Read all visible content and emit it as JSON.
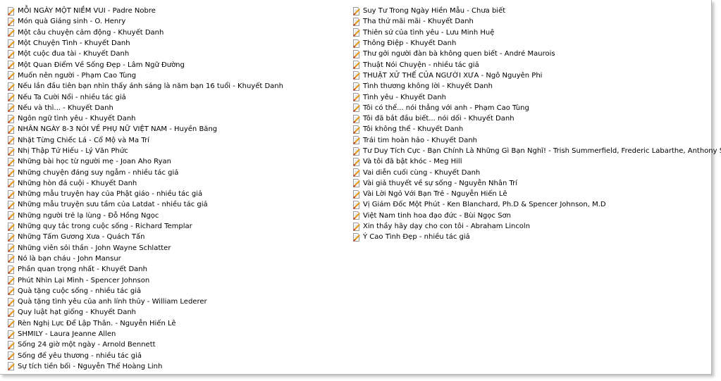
{
  "colors": {
    "background": "#ffffff",
    "text": "#000000",
    "icon_page": "#ffffff",
    "icon_border": "#9a9a9a",
    "icon_pencil": "#e39a1e",
    "icon_pencil_tip": "#c0392b"
  },
  "item_icon": "document-pencil-icon",
  "files": {
    "column1": [
      "MỖI NGÀY MỘT NIỀM VUI - Padre Nobre",
      "Món quà Giáng sinh - O. Henry",
      "Một câu chuyện cảm động - Khuyết Danh",
      "Một Chuyện Tình - Khuyết Danh",
      "Một cuộc đua tài - Khuyết Danh",
      "Một Quan Điểm Về Sống Đẹp - Lâm Ngữ Đường",
      "Muốn nên người - Phạm Cao Tùng",
      "Nếu lần đầu tiên bạn nhìn thấy ánh sáng là năm bạn 16 tuổi - Khuyết Danh",
      "Nếu Ta Cười Nổi - nhiều tác giả",
      "Nếu và thì... - Khuyết Danh",
      "Ngôn ngữ tình yêu - Khuyết Danh",
      "NHÂN NGÀY 8-3 NÓI VỀ PHỤ NỮ VIỆT NAM - Huyền Băng",
      "Nhặt Từng Chiếc Lá - Cổ Mộ và Ma Trí",
      "Nhị Thập Tứ Hiếu - Lý Văn Phức",
      "Những bài học từ người mẹ - Joan Aho Ryan",
      "Những chuyện đáng suy ngẫm - nhiều tác giả",
      "Những hòn đá cuội - Khuyết Danh",
      "Những mẫu truyện hay của Phật giáo - nhiều tác giả",
      "Những mẫu truyện sưu tầm của Latdat - nhiều tác giả",
      "Những người trẻ lạ lùng - Đỗ Hồng Ngọc",
      "Những quy tắc trong cuộc sống - Richard Templar",
      "Những Tấm Gương Xưa - Quách Tấn",
      "Những viên sỏi thần - John Wayne Schlatter",
      "Nó là bạn cháu - John Mansur",
      "Phần quan trọng nhất - Khuyết Danh",
      "Phút Nhìn Lại Mình - Spencer Johnson",
      "Quà tặng cuộc sống - nhiều tác giả",
      "Quà tặng tình yêu của anh lính thủy - William Lederer",
      "Quy luật hạt giống - Khuyết Danh",
      "Rèn Nghị Lực Để Lập Thân. - Nguyễn Hiến Lê",
      "SHMILY - Laura Jeanne Allen",
      "Sống 24 giờ một ngày - Arnold Bennett",
      "Sống để yêu thương - nhiều tác giả",
      "Sự tích tiền bối - Nguyễn Thế Hoàng Linh"
    ],
    "column2": [
      "Suy Tư Trong Ngày Hiền Mẫu - Chưa biết",
      "Tha thứ mãi mãi - Khuyết Danh",
      "Thiên sứ của tình yêu - Lưu Minh Huệ",
      "Thông Điệp - Khuyết Danh",
      "Thư gởi người đàn bà không quen biết - André Maurois",
      "Thuật Nói Chuyện - nhiều tác giả",
      "THUẬT XỬ THẾ CỦA NGƯỜI XƯA - Ngô Nguyên Phi",
      "Tình thương không lời - Khuyết Danh",
      "Tình yêu - Khuyết Danh",
      "Tôi có thể... nói thẳng với anh - Phạm Cao Tùng",
      "Tôi đã bắt đầu biết... nói dối - Khuyết Danh",
      "Tôi không thể - Khuyết Danh",
      "Trái tim hoàn hảo - Khuyết Danh",
      "Tư Duy Tích Cực - Bạn Chính Là Những Gì Bạn Nghĩ! - Trish Summerfield, Frederic Labarthe, Anthony Strano",
      "Và tôi đã bật khóc - Meg Hill",
      "Vai diễn cuối cùng - Khuyết Danh",
      "Vài giả thuyết về sự sống - Nguyễn Nhân Trí",
      "Vài Lời Ngỏ Với Bạn Trẻ - Nguyễn Hiến Lê",
      "Vị Giám Đốc Một Phút - Ken Blanchard, Ph.D & Spencer Johnson, M.D",
      "Việt Nam tinh hoa đạo đức - Bùi Ngọc Sơn",
      "Xin thầy hãy dạy cho con tôi - Abraham Lincoln",
      "Ý Cao Tình Đẹp - nhiều tác giả"
    ]
  }
}
